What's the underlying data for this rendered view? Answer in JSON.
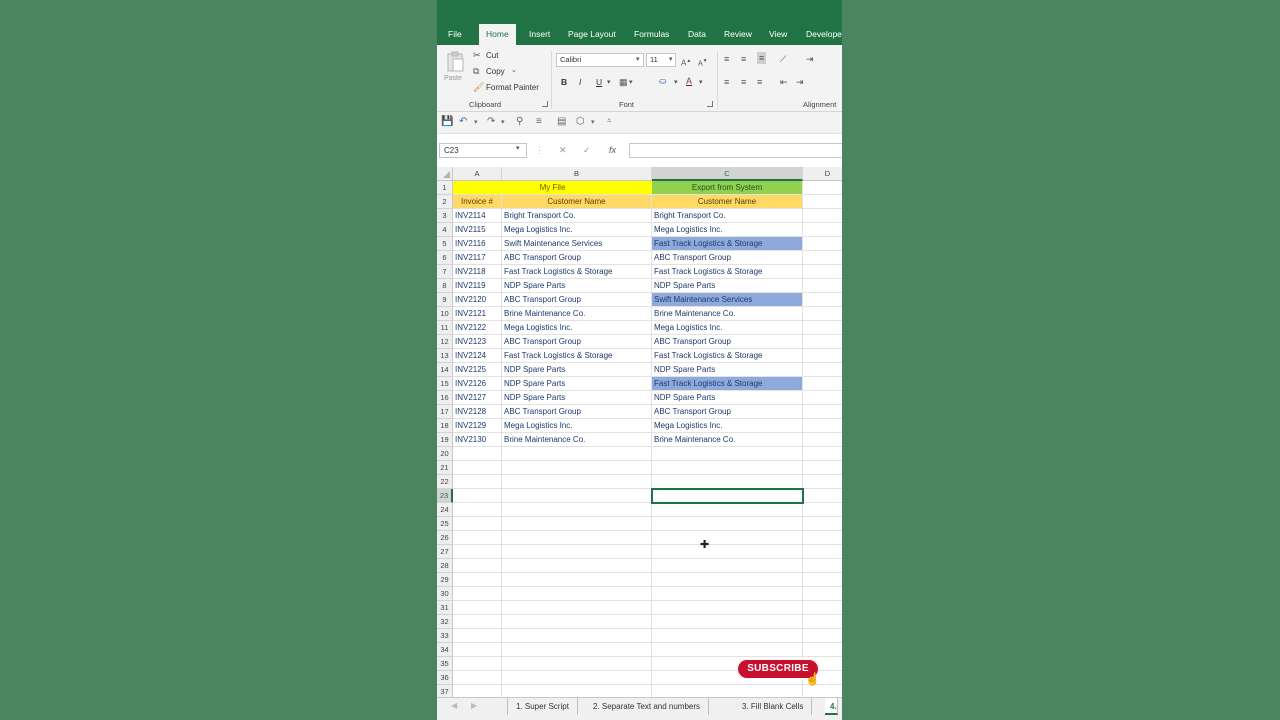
{
  "ribbon": {
    "tabs": [
      "File",
      "Home",
      "Insert",
      "Page Layout",
      "Formulas",
      "Data",
      "Review",
      "View",
      "Develope"
    ],
    "active_tab": "Home",
    "clipboard": {
      "paste": "Paste",
      "cut": "Cut",
      "copy": "Copy",
      "format_painter": "Format Painter",
      "group": "Clipboard"
    },
    "font": {
      "name": "Calibri",
      "size": "11",
      "bold": "B",
      "italic": "I",
      "underline": "U",
      "group": "Font"
    },
    "alignment_group": "Alignment"
  },
  "formula_bar": {
    "name_box": "C23",
    "fx": "fx",
    "value": ""
  },
  "columns": [
    "A",
    "B",
    "C",
    "D"
  ],
  "selected_column": "C",
  "row_numbers": [
    "1",
    "2",
    "3",
    "4",
    "5",
    "6",
    "7",
    "8",
    "9",
    "10",
    "11",
    "12",
    "13",
    "14",
    "15",
    "16",
    "17",
    "18",
    "19",
    "20",
    "21",
    "22",
    "23",
    "24",
    "25",
    "26",
    "27",
    "28",
    "29",
    "30",
    "31",
    "32",
    "33",
    "34",
    "35",
    "36",
    "37"
  ],
  "selected_row": "23",
  "headers": {
    "my_file": "My File",
    "export": "Export from System",
    "invoice": "Invoice #",
    "customer_b": "Customer Name",
    "customer_c": "Customer Name"
  },
  "rows": [
    {
      "inv": "INV2114",
      "b": "Bright Transport Co.",
      "c": "Bright Transport Co.",
      "diff": false
    },
    {
      "inv": "INV2115",
      "b": "Mega Logistics Inc.",
      "c": "Mega Logistics Inc.",
      "diff": false
    },
    {
      "inv": "INV2116",
      "b": "Swift Maintenance Services",
      "c": "Fast Track Logistics & Storage",
      "diff": true
    },
    {
      "inv": "INV2117",
      "b": "ABC Transport Group",
      "c": "ABC Transport Group",
      "diff": false
    },
    {
      "inv": "INV2118",
      "b": "Fast Track Logistics & Storage",
      "c": "Fast Track Logistics & Storage",
      "diff": false
    },
    {
      "inv": "INV2119",
      "b": "NDP Spare Parts",
      "c": "NDP Spare Parts",
      "diff": false
    },
    {
      "inv": "INV2120",
      "b": "ABC Transport Group",
      "c": "Swift Maintenance Services",
      "diff": true
    },
    {
      "inv": "INV2121",
      "b": "Brine Maintenance Co.",
      "c": "Brine Maintenance Co.",
      "diff": false
    },
    {
      "inv": "INV2122",
      "b": "Mega Logistics Inc.",
      "c": "Mega Logistics Inc.",
      "diff": false
    },
    {
      "inv": "INV2123",
      "b": "ABC Transport Group",
      "c": "ABC Transport Group",
      "diff": false
    },
    {
      "inv": "INV2124",
      "b": "Fast Track Logistics & Storage",
      "c": "Fast Track Logistics & Storage",
      "diff": false
    },
    {
      "inv": "INV2125",
      "b": "NDP Spare Parts",
      "c": "NDP Spare Parts",
      "diff": false
    },
    {
      "inv": "INV2126",
      "b": "NDP Spare Parts",
      "c": "Fast Track Logistics & Storage",
      "diff": true
    },
    {
      "inv": "INV2127",
      "b": "NDP Spare Parts",
      "c": "NDP Spare Parts",
      "diff": false
    },
    {
      "inv": "INV2128",
      "b": "ABC Transport Group",
      "c": "ABC Transport Group",
      "diff": false
    },
    {
      "inv": "INV2129",
      "b": "Mega Logistics Inc.",
      "c": "Mega Logistics Inc.",
      "diff": false
    },
    {
      "inv": "INV2130",
      "b": "Brine Maintenance Co.",
      "c": "Brine Maintenance Co.",
      "diff": false
    }
  ],
  "sheet_tabs": [
    "1. Super Script",
    "2. Separate Text and numbers",
    "3. Fill Blank Cells",
    "4."
  ],
  "active_sheet": "4.",
  "subscribe_label": "SUBSCRIBE",
  "colors": {
    "excel_green": "#217346",
    "background": "#4a8461",
    "yellow_header": "#ffff00",
    "green_header": "#92d050",
    "orange_header": "#ffd966",
    "diff_highlight": "#8ea9db",
    "subscribe_red": "#c8102e"
  }
}
